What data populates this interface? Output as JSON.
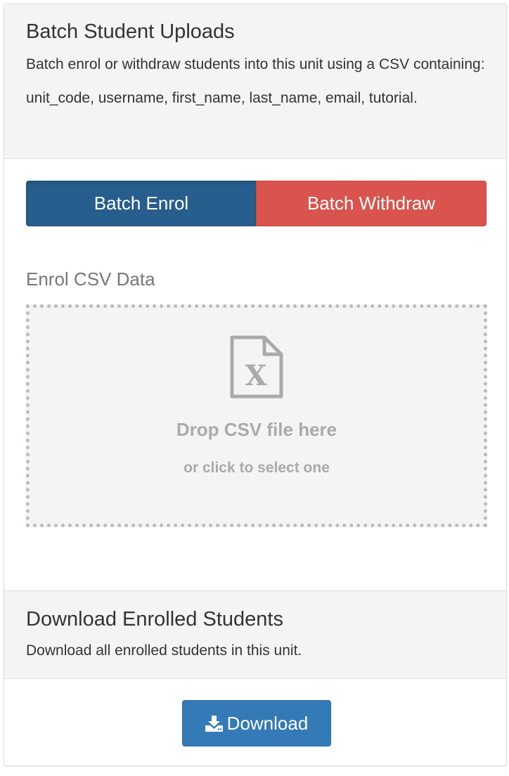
{
  "upload": {
    "title": "Batch Student Uploads",
    "description": "Batch enrol or withdraw students into this unit using a CSV containing: unit_code, username, first_name, last_name, email, tutorial.",
    "tabs": {
      "enrol_label": "Batch Enrol",
      "withdraw_label": "Batch Withdraw",
      "active": "Batch Enrol"
    },
    "field_label": "Enrol CSV Data",
    "dropzone": {
      "icon": "file-excel-icon",
      "title": "Drop CSV file here",
      "subtitle": "or click to select one"
    }
  },
  "download": {
    "title": "Download Enrolled Students",
    "description": "Download all enrolled students in this unit.",
    "button_label": "Download",
    "button_icon": "download-icon"
  },
  "colors": {
    "enrol_active": "#285e8e",
    "withdraw": "#d9534f",
    "download": "#337ab7",
    "heading_bg": "#f4f4f4"
  }
}
